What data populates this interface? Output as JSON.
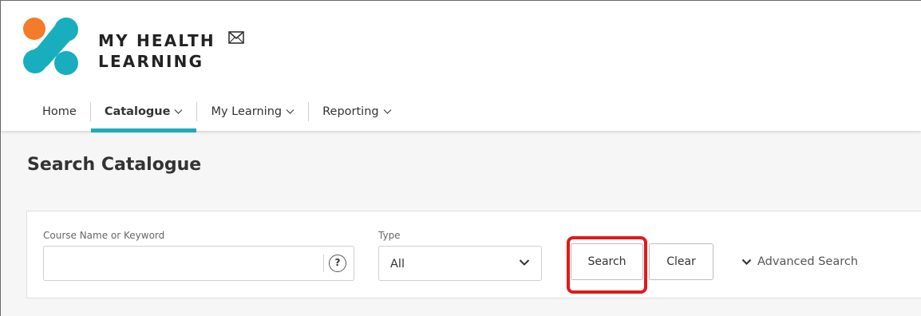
{
  "brand": {
    "line1": "MY HEALTH",
    "line2": "LEARNING"
  },
  "icons": {
    "logo": "my-health-learning-logo",
    "mail": "mail-icon",
    "help": "help-icon",
    "select_arrow": "chevron-down-icon"
  },
  "colors": {
    "accent": "#18aebd",
    "logo_orange": "#f47b2a",
    "logo_teal": "#18aebd",
    "highlight": "#e01a1a"
  },
  "nav": {
    "items": [
      {
        "label": "Home",
        "has_menu": false,
        "active": false
      },
      {
        "label": "Catalogue",
        "has_menu": true,
        "active": true
      },
      {
        "label": "My Learning",
        "has_menu": true,
        "active": false
      },
      {
        "label": "Reporting",
        "has_menu": true,
        "active": false
      }
    ]
  },
  "page": {
    "title": "Search Catalogue"
  },
  "search": {
    "keyword_label": "Course Name or Keyword",
    "keyword_value": "",
    "help_glyph": "?",
    "type_label": "Type",
    "type_value": "All",
    "search_button": "Search",
    "clear_button": "Clear",
    "advanced_link": "Advanced Search"
  }
}
